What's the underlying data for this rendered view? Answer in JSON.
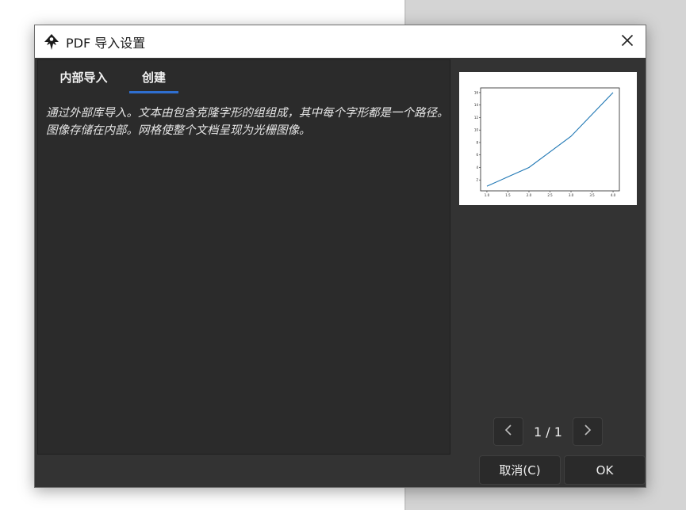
{
  "dialog": {
    "title": "PDF 导入设置"
  },
  "tabs": [
    {
      "label": "内部导入",
      "active": false
    },
    {
      "label": "创建",
      "active": true
    }
  ],
  "description": "通过外部库导入。文本由包含克隆字形的组组成，其中每个字形都是一个路径。图像存储在内部。网格使整个文档呈现为光栅图像。",
  "pager": {
    "label": "1 / 1"
  },
  "buttons": {
    "cancel": "取消(C)",
    "ok": "OK"
  },
  "colors": {
    "accent": "#2f6fd0",
    "dialog_bg": "#333333",
    "panel_bg": "#2b2b2b",
    "line": "#1f77b4"
  },
  "icons": [
    "inkscape-icon",
    "close-icon",
    "chevron-left-icon",
    "chevron-right-icon"
  ],
  "chart_data": {
    "type": "line",
    "x": [
      1.0,
      1.5,
      2.0,
      2.5,
      3.0,
      3.5,
      4.0
    ],
    "y": [
      1,
      2.5,
      4,
      6.5,
      9,
      12.5,
      16
    ],
    "xticks": [
      "1.0",
      "1.5",
      "2.0",
      "2.5",
      "3.0",
      "3.5",
      "4.0"
    ],
    "yticks": [
      "2",
      "4",
      "6",
      "8",
      "10",
      "12",
      "14",
      "16"
    ],
    "xlim": [
      0.85,
      4.15
    ],
    "ylim": [
      0.25,
      16.75
    ]
  }
}
